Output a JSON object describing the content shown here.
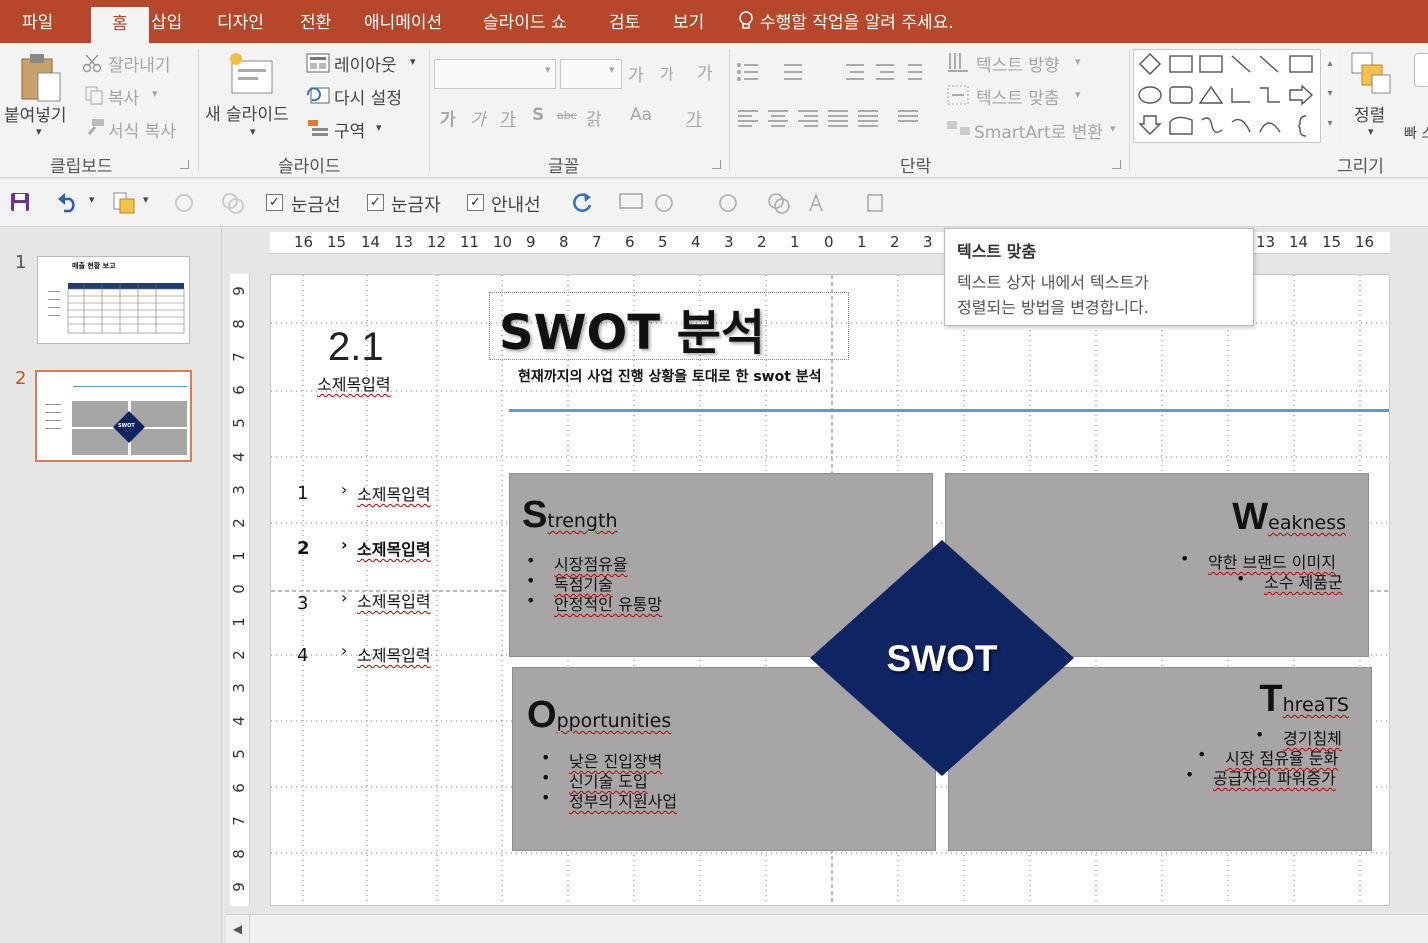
{
  "tabs": [
    "파일",
    "홈",
    "삽입",
    "디자인",
    "전환",
    "애니메이션",
    "슬라이드 쇼",
    "검토",
    "보기"
  ],
  "active_tab": "홈",
  "tell_me": "수행할 작업을 알려 주세요.",
  "ribbon": {
    "clipboard": {
      "paste": "붙여넣기",
      "cut": "잘라내기",
      "copy": "복사",
      "format_painter": "서식 복사",
      "group": "클립보드"
    },
    "slides": {
      "new_slide": "새 슬라이드",
      "layout": "레이아웃",
      "reset": "다시 설정",
      "section": "구역",
      "group": "슬라이드"
    },
    "font": {
      "grow": "가",
      "shrink": "가",
      "clear": "가",
      "bold": "가",
      "italic": "가",
      "underline": "가",
      "strike": "S",
      "spacing": "가",
      "case": "Aa",
      "color": "가",
      "group": "글꼴",
      "shadow_abc": "abc",
      "spacing2": "갉"
    },
    "paragraph": {
      "text_direction": "텍스트 방향",
      "align_text": "텍스트 맞춤",
      "smartart": "SmartArt로 변환",
      "group": "단락"
    },
    "drawing": {
      "arrange": "정렬",
      "group": "그리기",
      "styles_partial": "빠 스타"
    }
  },
  "qat": {
    "gridlines": "눈금선",
    "ruler": "눈금자",
    "guides": "안내선",
    "gridlines_checked": true,
    "ruler_checked": true,
    "guides_checked": true
  },
  "thumbs": [
    {
      "num": "1",
      "title": "매출 현황 보고"
    },
    {
      "num": "2",
      "title": "SWOT"
    }
  ],
  "ruler": {
    "h": [
      "16",
      "15",
      "14",
      "13",
      "12",
      "11",
      "10",
      "9",
      "8",
      "7",
      "6",
      "5",
      "4",
      "3",
      "2",
      "1",
      "0",
      "1",
      "2",
      "3",
      "13",
      "14",
      "15",
      "16"
    ],
    "v": [
      "9",
      "8",
      "7",
      "6",
      "5",
      "4",
      "3",
      "2",
      "1",
      "0",
      "1",
      "2",
      "3",
      "4",
      "5",
      "6",
      "7",
      "8",
      "9"
    ]
  },
  "tooltip": {
    "title": "텍스트 맞춤",
    "line1": "텍스트 상자 내에서 텍스트가",
    "line2": "정렬되는 방법을 변경합니다."
  },
  "slide": {
    "section_num": "2.1",
    "section_sub": "소제목입력",
    "title": "SWOT 분석",
    "subtitle": "현재까지의 사업 진행 상황을 토대로 한 swot 분석",
    "accent_color": "#5b9bd5",
    "toc": [
      {
        "num": "1",
        "label": "소제목입력",
        "bold": false
      },
      {
        "num": "2",
        "label": "소제목입력",
        "bold": true
      },
      {
        "num": "3",
        "label": "소제목입력",
        "bold": false
      },
      {
        "num": "4",
        "label": "소제목입력",
        "bold": false
      }
    ],
    "diamond_label": "SWOT",
    "diamond_color": "#0f2463",
    "quad_color": "#a7a5a5",
    "strength": {
      "letter": "S",
      "rest": "trength",
      "items": [
        "시장점유율",
        "독점기술",
        "안정적인 유통망"
      ]
    },
    "weakness": {
      "letter": "W",
      "rest": "eakness",
      "items": [
        "약한 브랜드 이미지",
        "소수 제품군"
      ]
    },
    "opportunities": {
      "letter": "O",
      "rest": "pportunities",
      "items": [
        "낮은 진입장벽",
        "신기술 도입",
        "정부의 지원사업"
      ]
    },
    "threats": {
      "letter": "T",
      "rest": "hreaTS",
      "items": [
        "경기침체",
        "시장 점유율 둔화",
        "공급자의 파워증가"
      ]
    }
  }
}
